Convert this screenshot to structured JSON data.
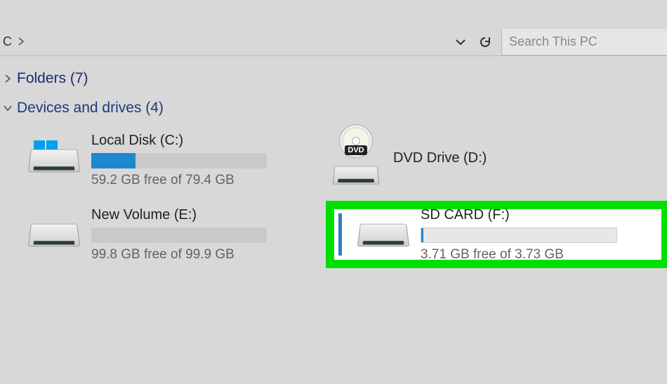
{
  "address": {
    "current": "C"
  },
  "search": {
    "placeholder": "Search This PC"
  },
  "groups": {
    "folders": {
      "label": "Folders (7)",
      "expanded": false
    },
    "devices": {
      "label": "Devices and drives (4)",
      "expanded": true
    }
  },
  "drives": {
    "c": {
      "name": "Local Disk (C:)",
      "free": "59.2 GB free of 79.4 GB",
      "used_percent": 25
    },
    "d": {
      "name": "DVD Drive (D:)"
    },
    "e": {
      "name": "New Volume (E:)",
      "free": "99.8 GB free of 99.9 GB",
      "used_percent": 0
    },
    "f": {
      "name": "SD CARD (F:)",
      "free": "3.71 GB free of 3.73 GB",
      "used_percent": 1
    }
  },
  "highlight_color": "#00e000"
}
